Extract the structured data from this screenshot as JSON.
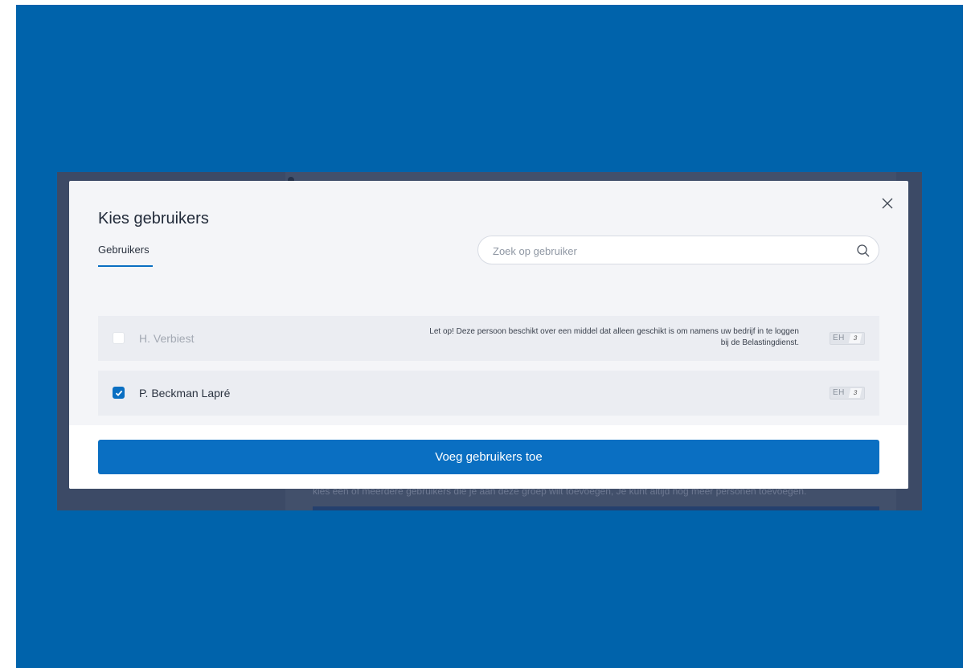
{
  "colors": {
    "page_background": "#0063ab",
    "overlay": "#3c4a66",
    "accent": "#0a6fc2",
    "row_background": "#ebedf2"
  },
  "background": {
    "text": "kies een of meerdere gebruikers die je aan deze groep wilt toevoegen, Je kunt altijd nog meer personen toevoegen."
  },
  "modal": {
    "title": "Kies gebruikers",
    "close_icon": "close-icon",
    "tab_label": "Gebruikers",
    "search": {
      "placeholder": "Zoek op gebruiker",
      "icon": "search-icon"
    },
    "users": [
      {
        "name": "H. Verbiest",
        "checked": false,
        "warning": "Let op! Deze persoon beschikt over een middel dat alleen geschikt is om namens uw bedrijf in te loggen bij de Belastingdienst.",
        "badge_mark": "EH",
        "badge_level": "3"
      },
      {
        "name": "P. Beckman Lapré",
        "checked": true,
        "warning": "",
        "badge_mark": "EH",
        "badge_level": "3"
      }
    ],
    "submit_label": "Voeg gebruikers toe"
  }
}
